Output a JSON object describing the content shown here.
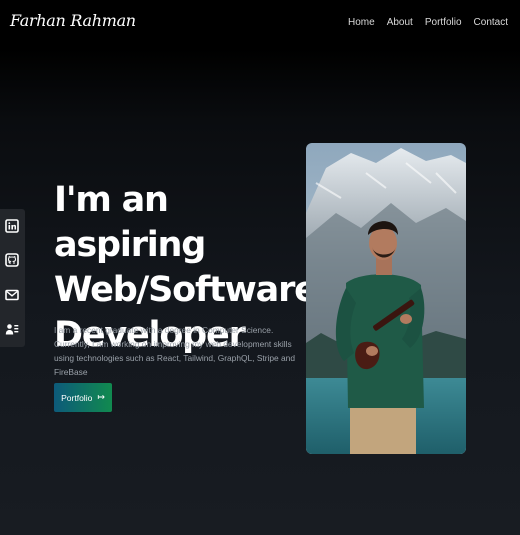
{
  "header": {
    "brand": "Farhan Rahman"
  },
  "nav": {
    "items": [
      "Home",
      "About",
      "Portfolio",
      "Contact"
    ]
  },
  "hero": {
    "title_lines": [
      "I'm an aspiring",
      "Web/Software",
      "Developer"
    ],
    "description": "I am a recent graduate with a degree in Computer Science. Currently, I am working on improving my web development skills using technologies such as React, Tailwind, GraphQL, Stripe and FireBase",
    "cta_label": "Portfolio",
    "cta_icon": "↦"
  },
  "social": {
    "icons": [
      "linkedin-icon",
      "github-icon",
      "mail-icon",
      "resume-icon"
    ]
  },
  "photo": {
    "subject": "portrait-photo"
  }
}
